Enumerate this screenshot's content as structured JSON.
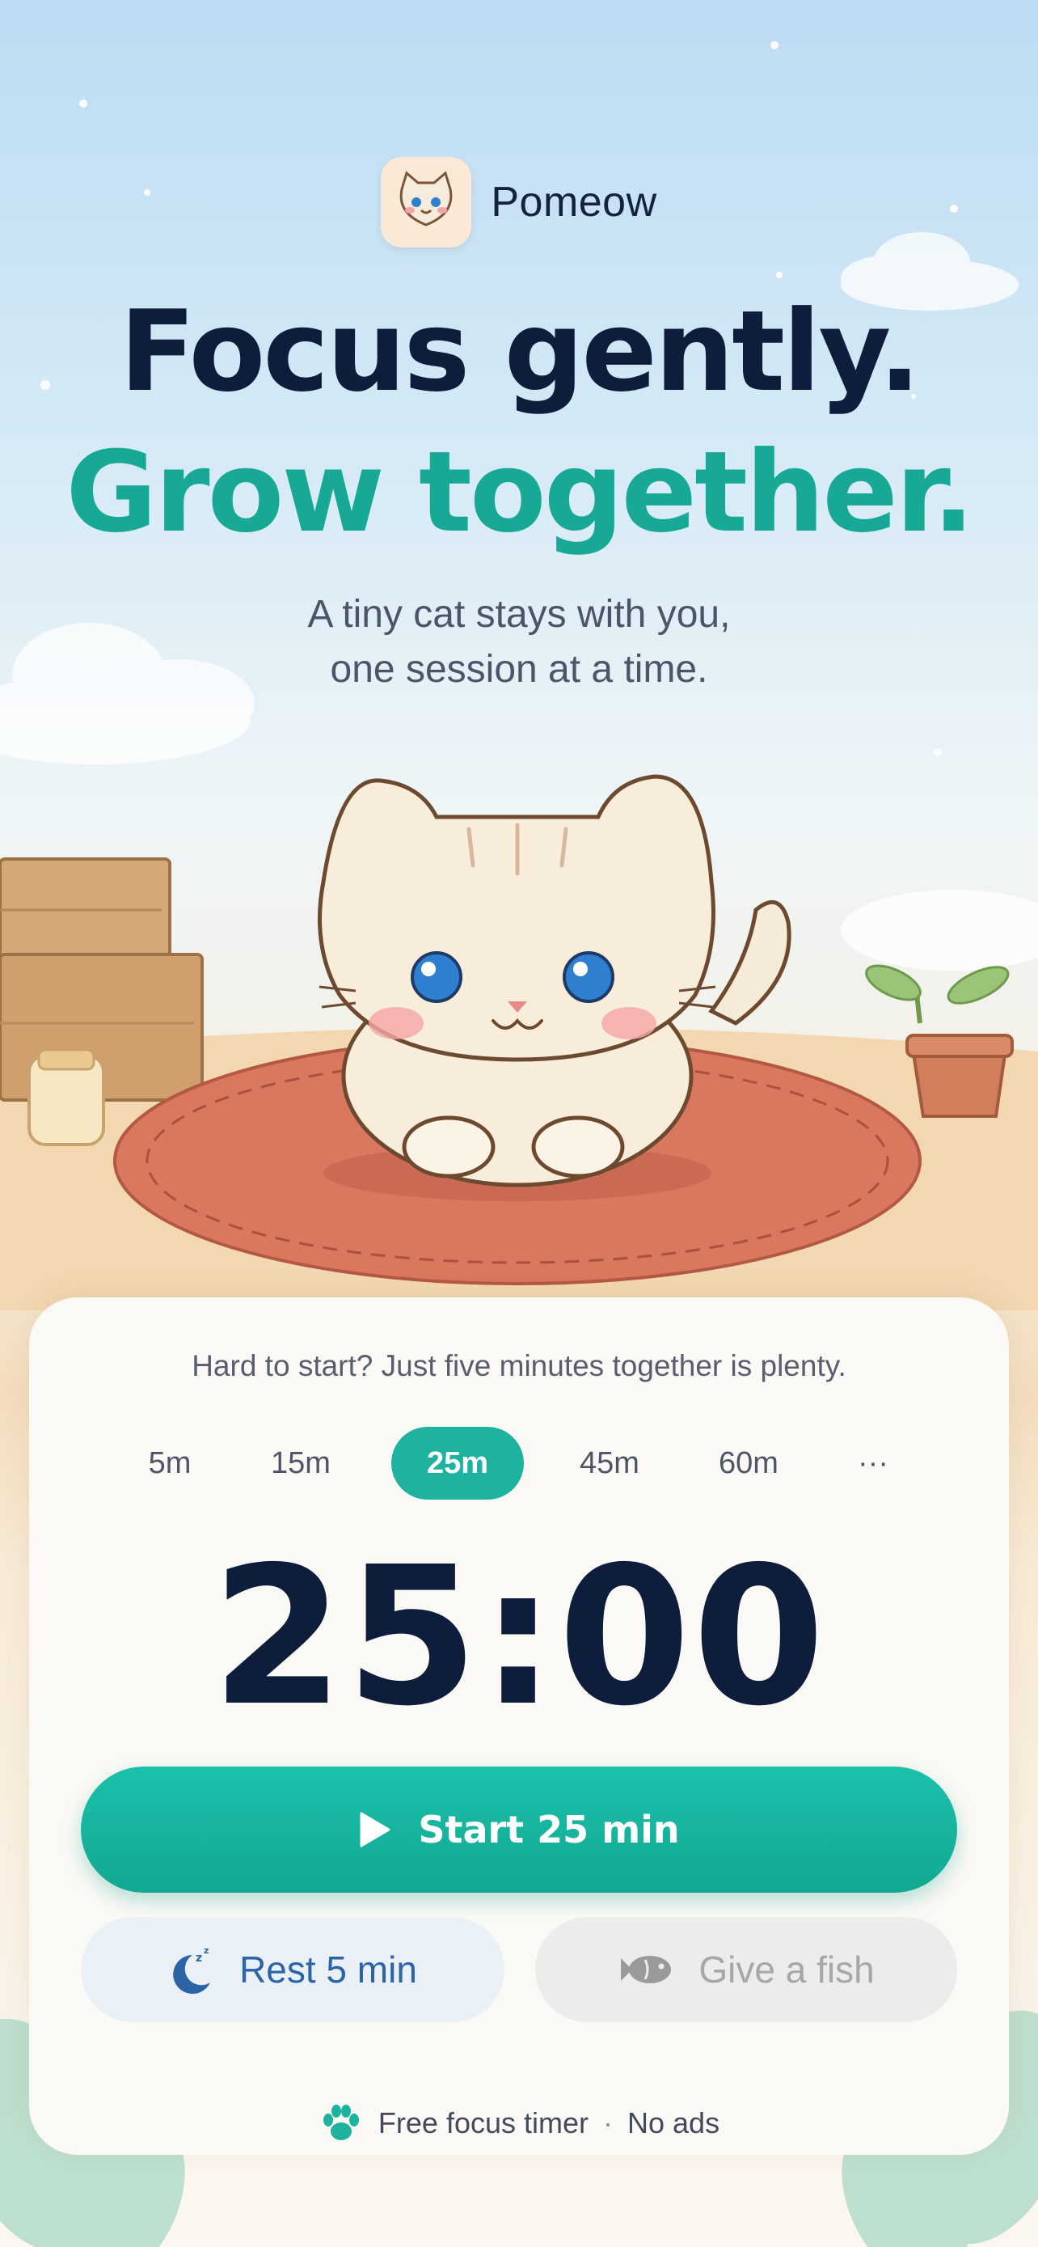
{
  "brand": {
    "name": "Pomeow",
    "logo_icon": "cat-face-icon"
  },
  "headline": {
    "line1": "Focus gently.",
    "line2": "Grow together."
  },
  "subtitle": {
    "line1": "A tiny cat stays with you,",
    "line2": "one session at a time."
  },
  "timer_card": {
    "hint": "Hard to start? Just five minutes together is plenty.",
    "presets": [
      {
        "label": "5m",
        "active": false
      },
      {
        "label": "15m",
        "active": false
      },
      {
        "label": "25m",
        "active": true
      },
      {
        "label": "45m",
        "active": false
      },
      {
        "label": "60m",
        "active": false
      },
      {
        "label": "···",
        "active": false
      }
    ],
    "time": "25:00",
    "start_button": {
      "label": "Start 25 min",
      "icon": "play-icon"
    },
    "rest_button": {
      "label": "Rest 5 min",
      "icon": "moon-sleep-icon"
    },
    "fish_button": {
      "label": "Give a fish",
      "icon": "fish-icon",
      "disabled": true
    }
  },
  "footer": {
    "icon": "paw-icon",
    "text1": "Free focus timer",
    "separator": "·",
    "text2": "No ads"
  },
  "colors": {
    "accent": "#1db39f",
    "headline_dark": "#0f1d3d",
    "headline_teal": "#18a896",
    "rest_blue": "#2c64a6"
  }
}
